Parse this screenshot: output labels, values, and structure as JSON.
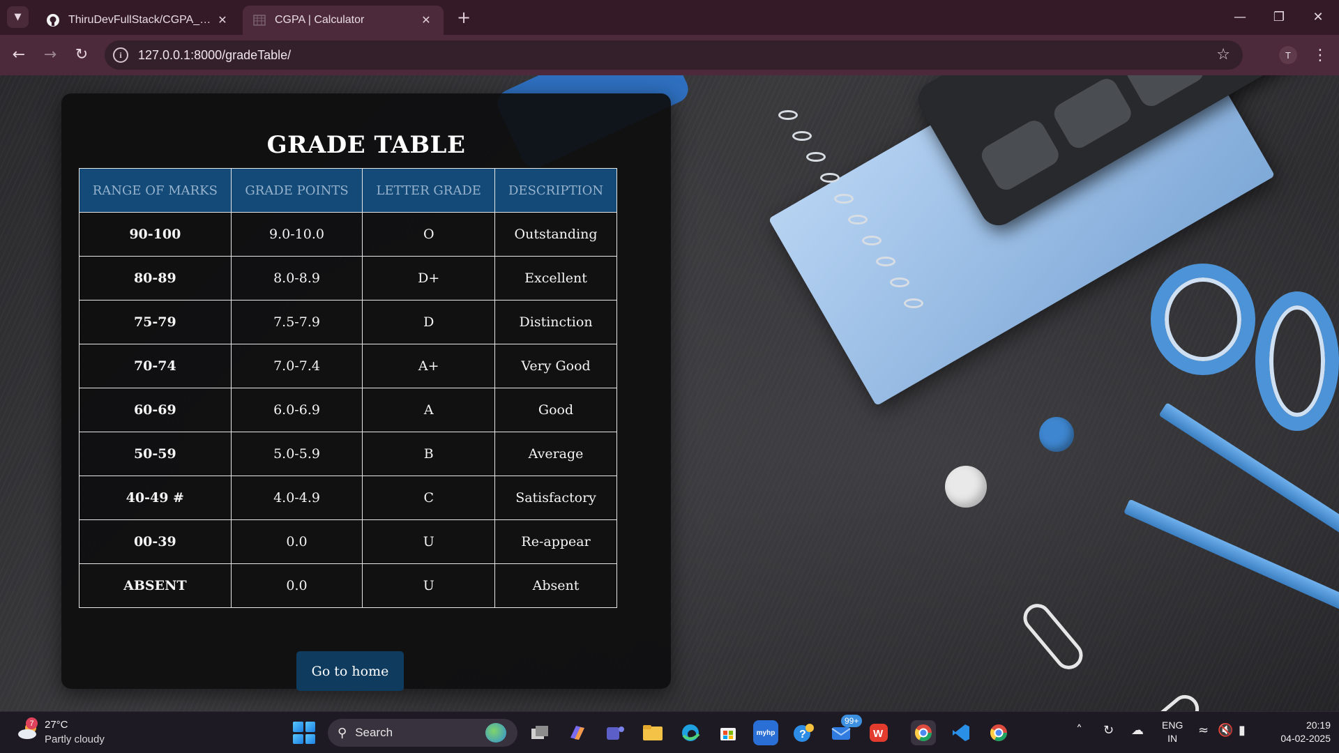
{
  "browser": {
    "tabs": [
      {
        "title": "ThiruDevFullStack/CGPA_Calculator",
        "icon": "github-icon",
        "active": false
      },
      {
        "title": "CGPA | Calculator",
        "icon": "page-icon",
        "active": true
      }
    ],
    "url": "127.0.0.1:8000/gradeTable/",
    "profile_initial": "T",
    "colors": {
      "frame": "#331a26",
      "toolbar": "#4d2a3b",
      "omnibox": "#33202a"
    }
  },
  "page": {
    "title": "GRADE TABLE",
    "table": {
      "headers": [
        "RANGE OF MARKS",
        "GRADE POINTS",
        "LETTER GRADE",
        "DESCRIPTION"
      ],
      "rows": [
        {
          "marks": "90-100",
          "points": "9.0-10.0",
          "letter": "O",
          "description": "Outstanding"
        },
        {
          "marks": "80-89",
          "points": "8.0-8.9",
          "letter": "D+",
          "description": "Excellent"
        },
        {
          "marks": "75-79",
          "points": "7.5-7.9",
          "letter": "D",
          "description": "Distinction"
        },
        {
          "marks": "70-74",
          "points": "7.0-7.4",
          "letter": "A+",
          "description": "Very Good"
        },
        {
          "marks": "60-69",
          "points": "6.0-6.9",
          "letter": "A",
          "description": "Good"
        },
        {
          "marks": "50-59",
          "points": "5.0-5.9",
          "letter": "B",
          "description": "Average"
        },
        {
          "marks": "40-49 #",
          "points": "4.0-4.9",
          "letter": "C",
          "description": "Satisfactory"
        },
        {
          "marks": "00-39",
          "points": "0.0",
          "letter": "U",
          "description": "Re-appear"
        },
        {
          "marks": "ABSENT",
          "points": "0.0",
          "letter": "U",
          "description": "Absent"
        }
      ]
    },
    "home_button": "Go to home",
    "colors": {
      "header_bg": "#134a78",
      "header_text": "#96b2cd",
      "button_bg": "#0e3b5e"
    }
  },
  "taskbar": {
    "weather": {
      "badge": "7",
      "temp": "27°C",
      "condition": "Partly cloudy"
    },
    "search_label": "Search",
    "mail_badge": "99+",
    "language": {
      "line1": "ENG",
      "line2": "IN"
    },
    "clock": {
      "time": "20:19",
      "date": "04-02-2025"
    }
  }
}
